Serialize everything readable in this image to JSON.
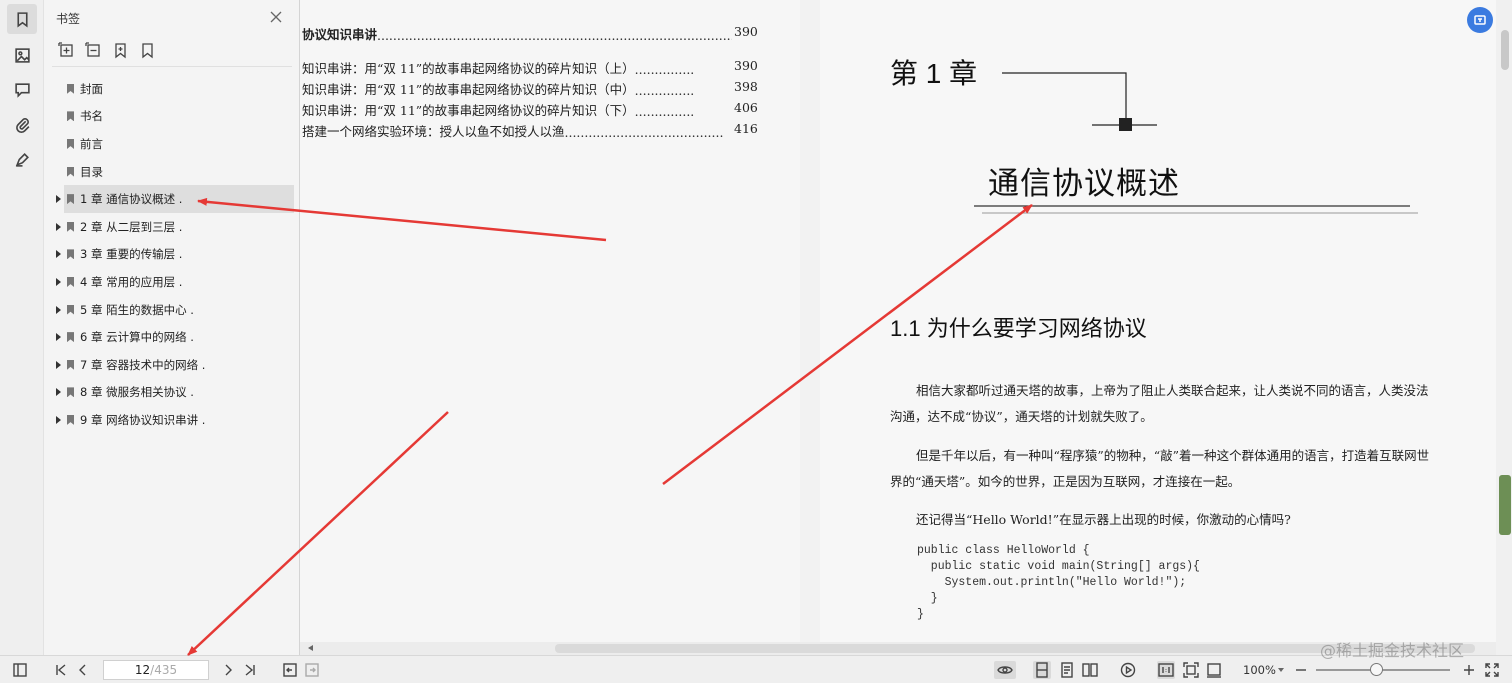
{
  "panel": {
    "title": "书签",
    "bookmarks": [
      {
        "label": "封面",
        "expandable": false,
        "selected": false
      },
      {
        "label": "书名",
        "expandable": false,
        "selected": false
      },
      {
        "label": "前言",
        "expandable": false,
        "selected": false
      },
      {
        "label": "目录",
        "expandable": false,
        "selected": false
      },
      {
        "label": "1 章 通信协议概述 .",
        "expandable": true,
        "selected": true
      },
      {
        "label": "2 章 从二层到三层 .",
        "expandable": true,
        "selected": false
      },
      {
        "label": "3 章 重要的传输层 .",
        "expandable": true,
        "selected": false
      },
      {
        "label": "4 章 常用的应用层 .",
        "expandable": true,
        "selected": false
      },
      {
        "label": "5 章 陌生的数据中心 .",
        "expandable": true,
        "selected": false
      },
      {
        "label": "6 章 云计算中的网络 .",
        "expandable": true,
        "selected": false
      },
      {
        "label": "7 章 容器技术中的网络 .",
        "expandable": true,
        "selected": false
      },
      {
        "label": "8 章 微服务相关协议 .",
        "expandable": true,
        "selected": false
      },
      {
        "label": "9 章 网络协议知识串讲 .",
        "expandable": true,
        "selected": false
      }
    ]
  },
  "toc": [
    {
      "text": "协议知识串讲",
      "leader": "..........................................................................................",
      "page": "390",
      "bold": true
    },
    {
      "text": "知识串讲：用“双 11”的故事串起网络协议的碎片知识（上）",
      "leader": "...............",
      "page": "390",
      "bold": false
    },
    {
      "text": "知识串讲：用“双 11”的故事串起网络协议的碎片知识（中）",
      "leader": "...............",
      "page": "398",
      "bold": false
    },
    {
      "text": "知识串讲：用“双 11”的故事串起网络协议的碎片知识（下）",
      "leader": "...............",
      "page": "406",
      "bold": false
    },
    {
      "text": "搭建一个网络实验环境：授人以鱼不如授人以渔",
      "leader": "........................................",
      "page": "416",
      "bold": false
    }
  ],
  "content": {
    "chapter": "第 1 章",
    "chapter_title": "通信协议概述",
    "section_title": "1.1   为什么要学习网络协议",
    "paragraphs": [
      "相信大家都听过通天塔的故事，上帝为了阻止人类联合起来，让人类说不同的语言，人类没法沟通，达不成“协议”，通天塔的计划就失败了。",
      "但是千年以后，有一种叫“程序猿”的物种，“敲”着一种这个群体通用的语言，打造着互联网世界的“通天塔”。如今的世界，正是因为互联网，才连接在一起。",
      "还记得当“Hello World!”在显示器上出现的时候，你激动的心情吗?"
    ],
    "code": "public class HelloWorld {\n  public static void main(String[] args){\n    System.out.println(\"Hello World!\");\n  }\n}"
  },
  "statusbar": {
    "current_page": "12",
    "total_pages": "/435",
    "zoom": "100%",
    "zoom_fraction": 0.45
  },
  "watermark": "@稀土掘金技术社区",
  "colors": {
    "accent": "#3b7be0",
    "annotation_arrow": "#e53935"
  }
}
